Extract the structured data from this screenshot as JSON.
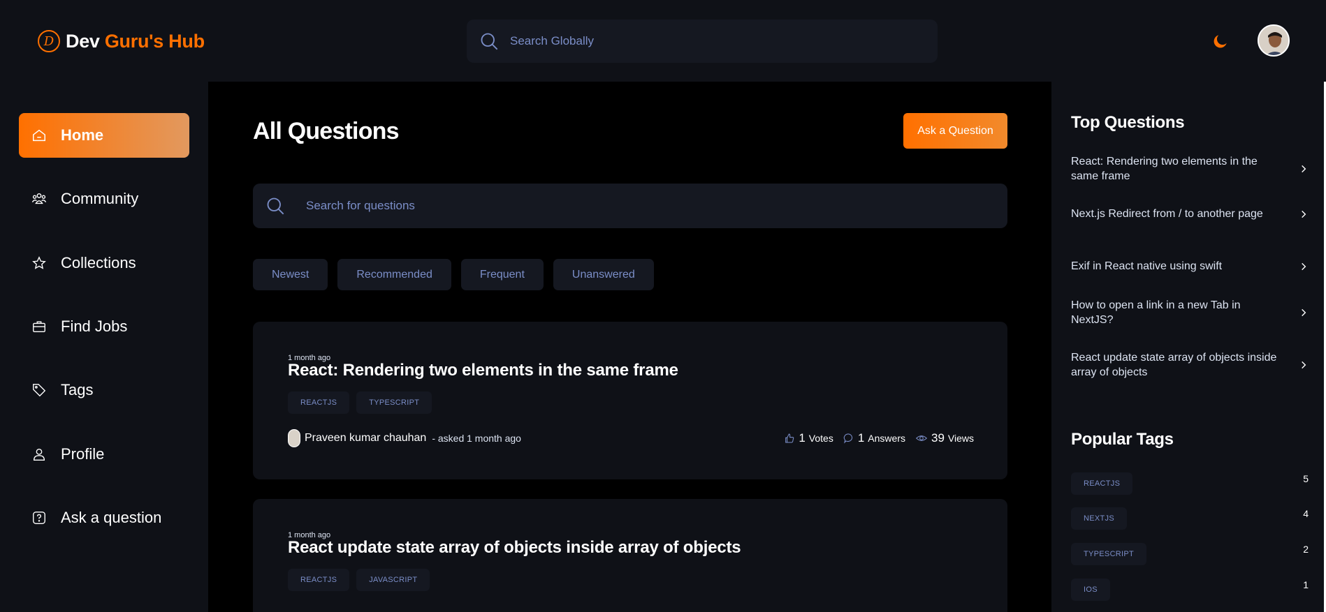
{
  "colors": {
    "accent": "#ff7000",
    "muted": "#7b8ec8",
    "card": "#0f1117",
    "chip": "#151821"
  },
  "header": {
    "logo_dev": "Dev",
    "logo_brand": "Guru's Hub",
    "search_placeholder": "Search Globally"
  },
  "sidebar": {
    "items": [
      {
        "label": "Home",
        "icon": "home-icon",
        "active": true
      },
      {
        "label": "Community",
        "icon": "users-icon"
      },
      {
        "label": "Collections",
        "icon": "star-icon"
      },
      {
        "label": "Find Jobs",
        "icon": "suitcase-icon"
      },
      {
        "label": "Tags",
        "icon": "tag-icon"
      },
      {
        "label": "Profile",
        "icon": "user-icon"
      },
      {
        "label": "Ask a question",
        "icon": "question-icon"
      }
    ]
  },
  "main": {
    "title": "All Questions",
    "ask_button": "Ask a Question",
    "search_placeholder": "Search for questions",
    "filters": [
      "Newest",
      "Recommended",
      "Frequent",
      "Unanswered"
    ],
    "questions": [
      {
        "time": "1 month ago",
        "title": "React: Rendering two elements in the same frame",
        "tags": [
          "REACTJS",
          "TYPESCRIPT"
        ],
        "author": "Praveen kumar chauhan",
        "asked": "- asked 1 month ago",
        "votes": "1",
        "votes_label": "Votes",
        "answers": "1",
        "answers_label": "Answers",
        "views": "39",
        "views_label": "Views"
      },
      {
        "time": "1 month ago",
        "title": "React update state array of objects inside array of objects",
        "tags": [
          "REACTJS",
          "JAVASCRIPT"
        ]
      }
    ]
  },
  "right": {
    "top_title": "Top Questions",
    "top_questions": [
      "React: Rendering two elements in the same frame",
      "Next.js Redirect from / to another page",
      "Exif in React native using swift",
      "How to open a link in a new Tab in NextJS?",
      "React update state array of objects inside array of objects"
    ],
    "tags_title": "Popular Tags",
    "popular_tags": [
      {
        "name": "REACTJS",
        "count": "5"
      },
      {
        "name": "NEXTJS",
        "count": "4"
      },
      {
        "name": "TYPESCRIPT",
        "count": "2"
      },
      {
        "name": "IOS",
        "count": "1"
      }
    ]
  }
}
